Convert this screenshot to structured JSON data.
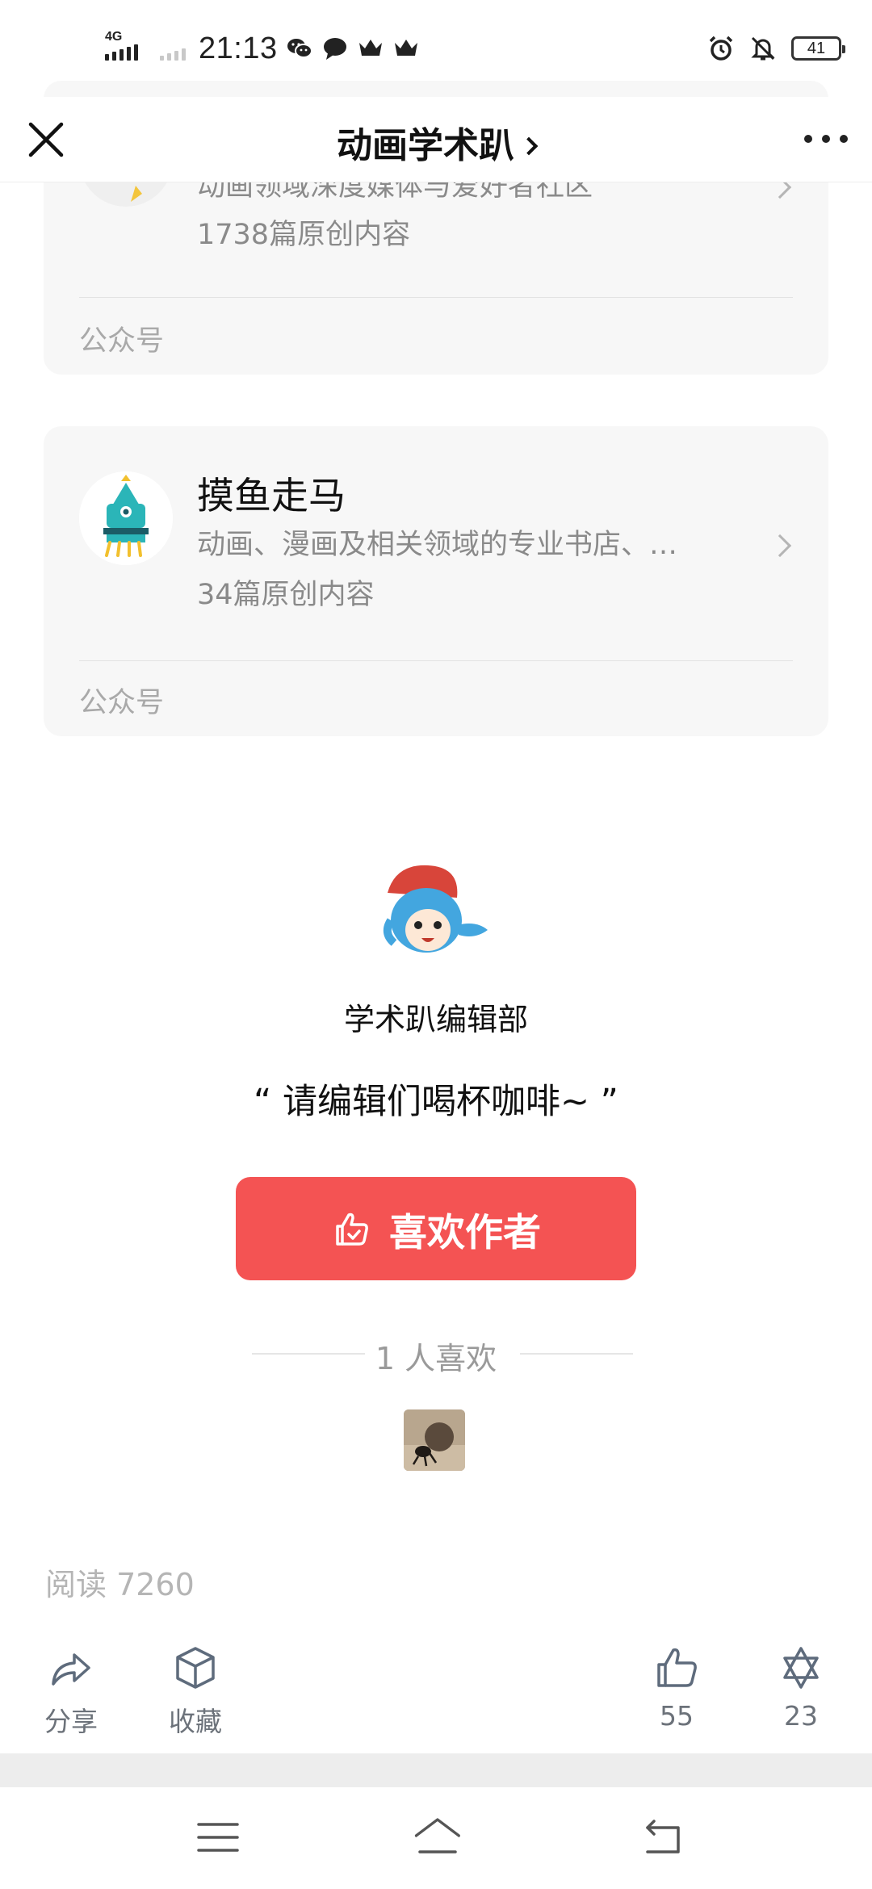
{
  "status_bar": {
    "network": "4G",
    "time": "21:13",
    "battery": "41"
  },
  "nav": {
    "title": "动画学术趴"
  },
  "cards": [
    {
      "name": "",
      "desc": "动画领域深度媒体与爱好者社区",
      "count": "1738篇原创内容",
      "type": "公众号"
    },
    {
      "name": "摸鱼走马",
      "desc": "动画、漫画及相关领域的专业书店、…",
      "count": "34篇原创内容",
      "type": "公众号"
    }
  ],
  "author": {
    "name": "学术趴编辑部",
    "quote": "“ 请编辑们喝杯咖啡~ ”",
    "like_button": "喜欢作者",
    "likers": "1 人喜欢"
  },
  "article": {
    "read_count": "阅读 7260"
  },
  "actions": {
    "share": "分享",
    "favorite": "收藏",
    "like_count": "55",
    "wow_count": "23"
  },
  "colors": {
    "like_button": "#f45353",
    "card_bg": "#f7f7f7",
    "muted_text": "#8a8a8a"
  }
}
